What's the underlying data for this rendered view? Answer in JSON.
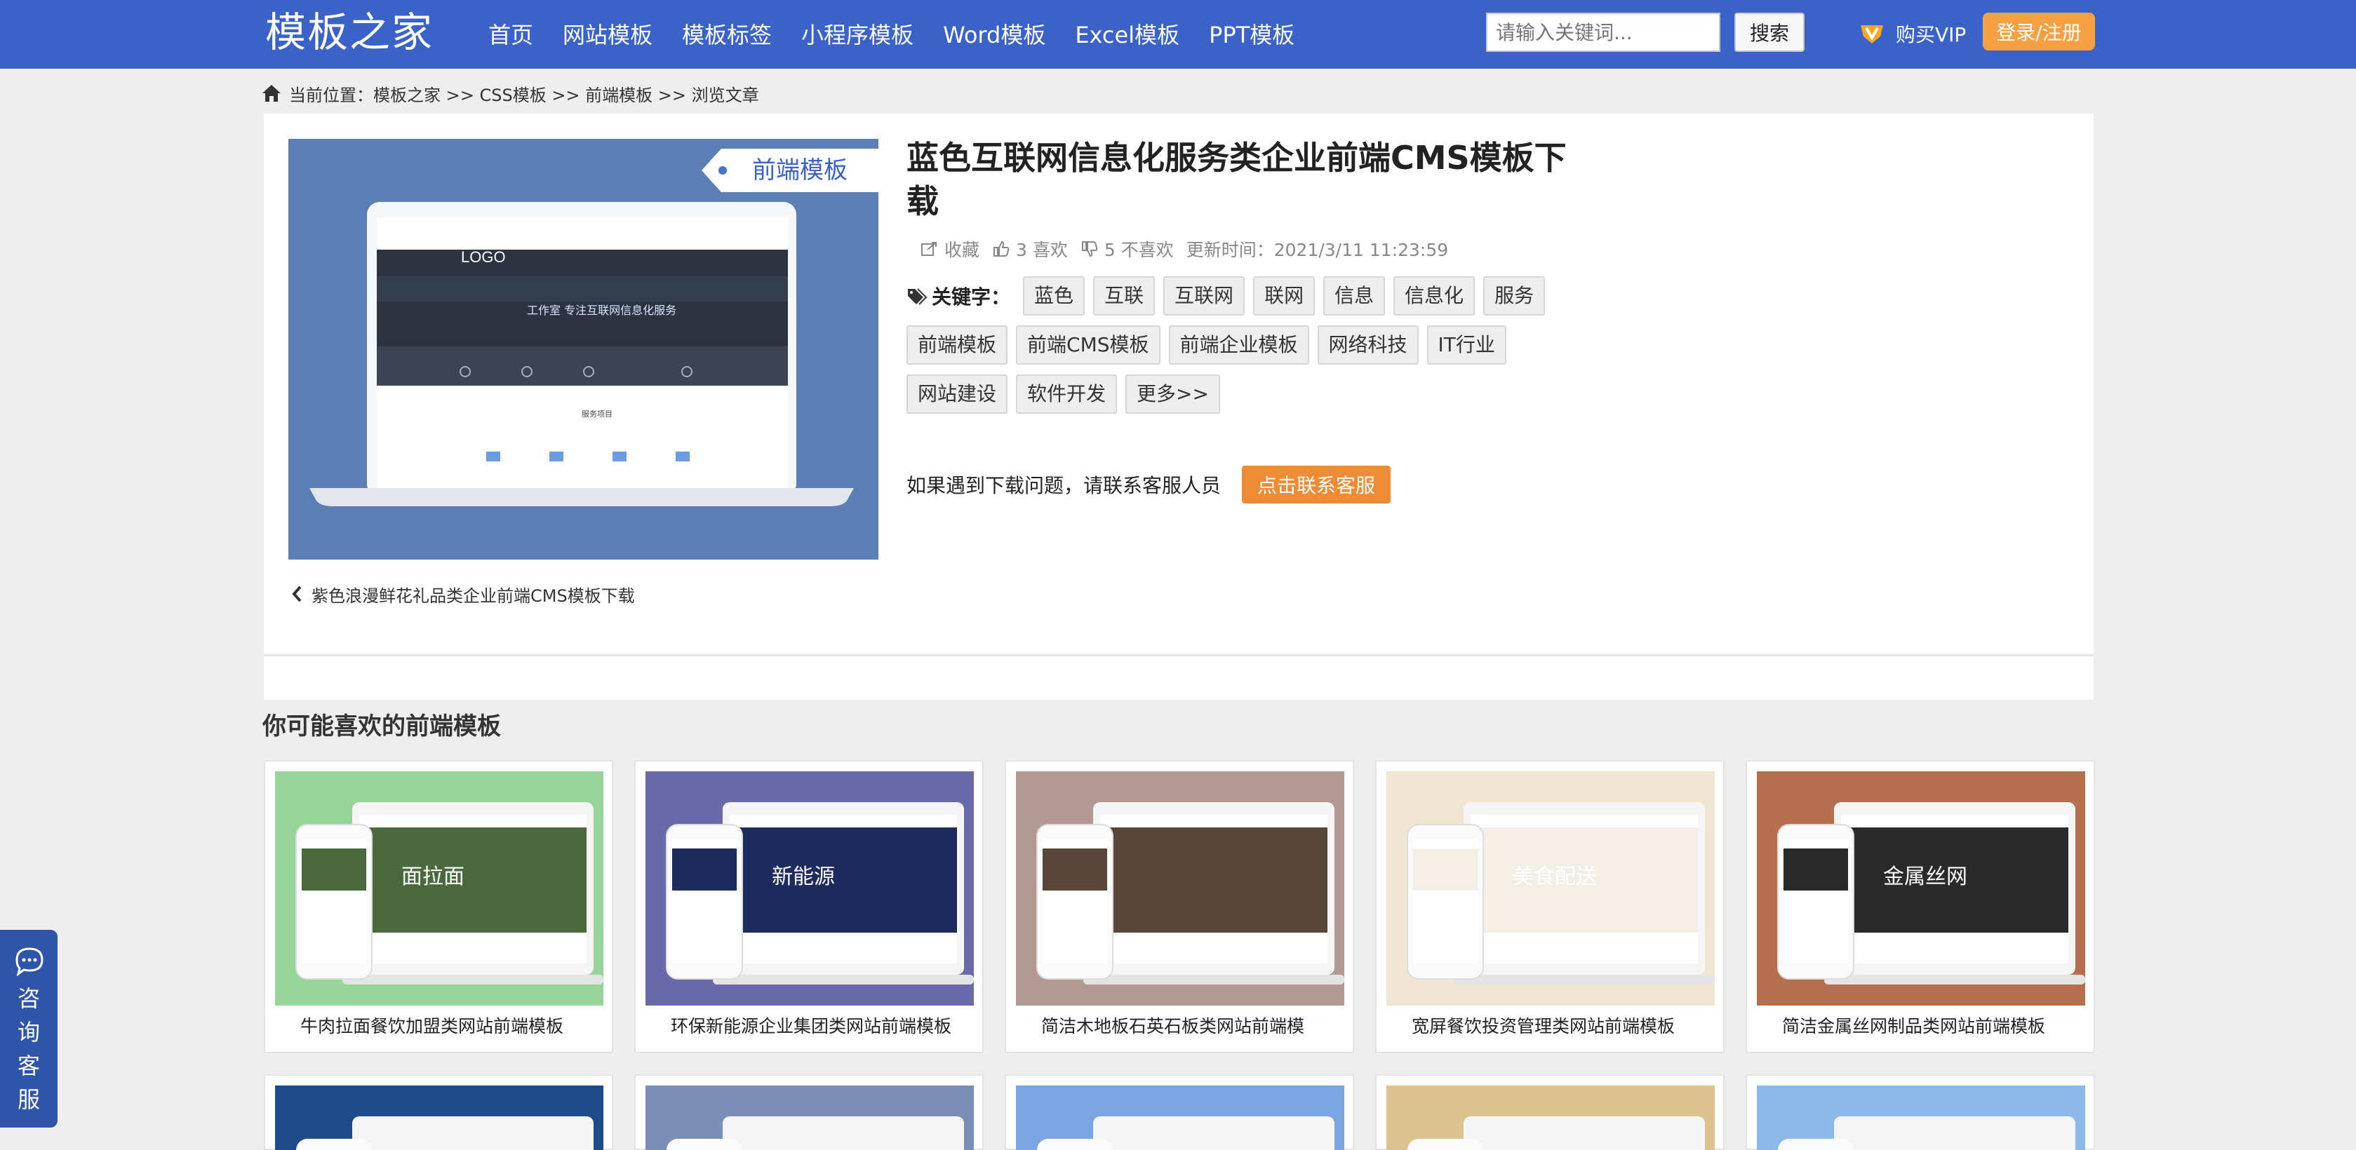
{
  "header": {
    "logo": "模板之家",
    "nav": [
      "首页",
      "网站模板",
      "模板标签",
      "小程序模板",
      "Word模板",
      "Excel模板",
      "PPT模板"
    ],
    "search_placeholder": "请输入关键词...",
    "search_button": "搜索",
    "vip_label": "购买VIP",
    "login_label": "登录/注册"
  },
  "breadcrumb": "当前位置：模板之家 >> CSS模板 >> 前端模板 >> 浏览文章",
  "article": {
    "title": "蓝色互联网信息化服务类企业前端CMS模板下载",
    "tag_ribbon": "前端模板",
    "preview_logo": "LOGO",
    "preview_banner": "工作室 专注互联网信息化服务",
    "preview_section": "服务项目",
    "favorite": "收藏",
    "likes": "3 喜欢",
    "dislikes": "5 不喜欢",
    "updated": "更新时间：2021/3/11 11:23:59",
    "keywords_label": "关键字：",
    "tags_row1": [
      "蓝色",
      "互联",
      "互联网",
      "联网",
      "信息",
      "信息化",
      "服务"
    ],
    "tags_row2": [
      "前端模板",
      "前端CMS模板",
      "前端企业模板",
      "网络科技",
      "IT行业"
    ],
    "tags_row3": [
      "网站建设",
      "软件开发",
      "更多>>"
    ],
    "help_text": "如果遇到下载问题，请联系客服人员",
    "help_button": "点击联系客服",
    "prev_article": "紫色浪漫鲜花礼品类企业前端CMS模板下载"
  },
  "recommend": {
    "title": "你可能喜欢的前端模板",
    "items": [
      {
        "caption": "牛肉拉面餐饮加盟类网站前端模板",
        "bg": "#95d59a",
        "screen": "#4a6a3e",
        "text": "面拉面"
      },
      {
        "caption": "环保新能源企业集团类网站前端模板",
        "bg": "#6a69aa",
        "screen": "#1c2a5e",
        "text": "新能源"
      },
      {
        "caption": "简洁木地板石英石板类网站前端模",
        "bg": "#b49892",
        "screen": "#5a4638",
        "text": ""
      },
      {
        "caption": "宽屏餐饮投资管理类网站前端模板",
        "bg": "#f0e6d2",
        "screen": "#f3eee6",
        "text": "美食配送"
      },
      {
        "caption": "简洁金属丝网制品类网站前端模板",
        "bg": "#b4704e",
        "screen": "#2a2a2a",
        "text": "金属丝网"
      }
    ],
    "row2_bg": [
      "#1d4a8a",
      "#7a8fb8",
      "#79a6e0",
      "#ddc38f",
      "#8ab9ea"
    ]
  },
  "consult": "咨询客服",
  "colors": {
    "header": "#3a62c8",
    "accent": "#f5a042",
    "help": "#f08b35"
  }
}
